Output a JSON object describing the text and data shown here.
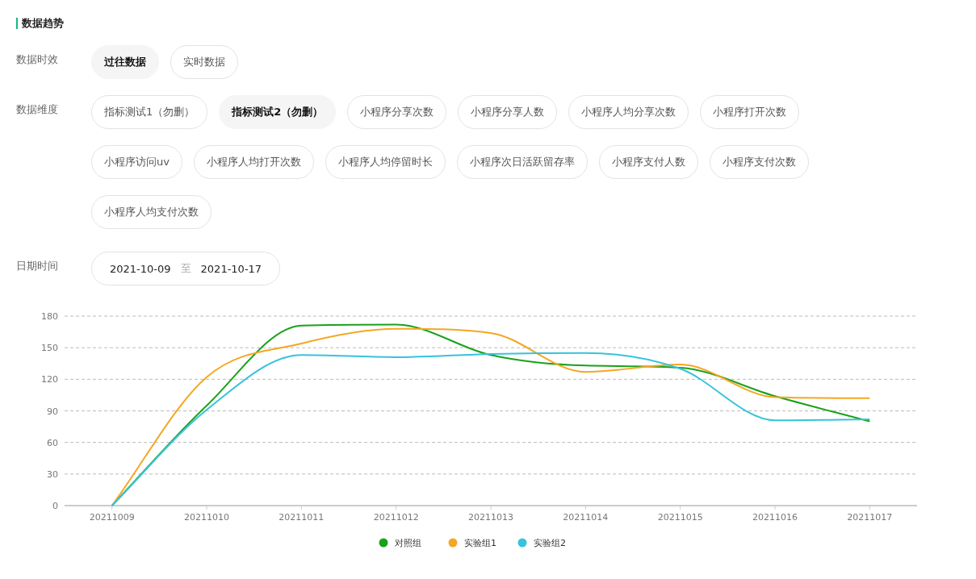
{
  "section_title": "数据趋势",
  "timeliness": {
    "label": "数据时效",
    "options": [
      {
        "label": "过往数据",
        "selected": true
      },
      {
        "label": "实时数据",
        "selected": false
      }
    ]
  },
  "dimension": {
    "label": "数据维度",
    "options": [
      {
        "label": "指标测试1（勿删）",
        "selected": false
      },
      {
        "label": "指标测试2（勿删）",
        "selected": true
      },
      {
        "label": "小程序分享次数",
        "selected": false
      },
      {
        "label": "小程序分享人数",
        "selected": false
      },
      {
        "label": "小程序人均分享次数",
        "selected": false
      },
      {
        "label": "小程序打开次数",
        "selected": false
      },
      {
        "label": "小程序访问uv",
        "selected": false
      },
      {
        "label": "小程序人均打开次数",
        "selected": false
      },
      {
        "label": "小程序人均停留时长",
        "selected": false
      },
      {
        "label": "小程序次日活跃留存率",
        "selected": false
      },
      {
        "label": "小程序支付人数",
        "selected": false
      },
      {
        "label": "小程序支付次数",
        "selected": false
      },
      {
        "label": "小程序人均支付次数",
        "selected": false
      }
    ]
  },
  "date_range": {
    "label": "日期时间",
    "start": "2021-10-09",
    "separator": "至",
    "end": "2021-10-17"
  },
  "chart_data": {
    "type": "line",
    "categories": [
      "20211009",
      "20211010",
      "20211011",
      "20211012",
      "20211013",
      "20211014",
      "20211015",
      "20211016",
      "20211017"
    ],
    "series": [
      {
        "name": "对照组",
        "color": "#1aa11a",
        "values": [
          0,
          95,
          171,
          172,
          143,
          133,
          131,
          104,
          80
        ]
      },
      {
        "name": "实验组1",
        "color": "#f5a623",
        "values": [
          0,
          122,
          154,
          168,
          164,
          127,
          134,
          103,
          102
        ]
      },
      {
        "name": "实验组2",
        "color": "#36c3db",
        "values": [
          0,
          91,
          143,
          141,
          144,
          145,
          130,
          81,
          82
        ]
      }
    ],
    "ylim": [
      0,
      180
    ],
    "yticks": [
      0,
      30,
      60,
      90,
      120,
      150,
      180
    ],
    "grid": true,
    "legend": true
  }
}
